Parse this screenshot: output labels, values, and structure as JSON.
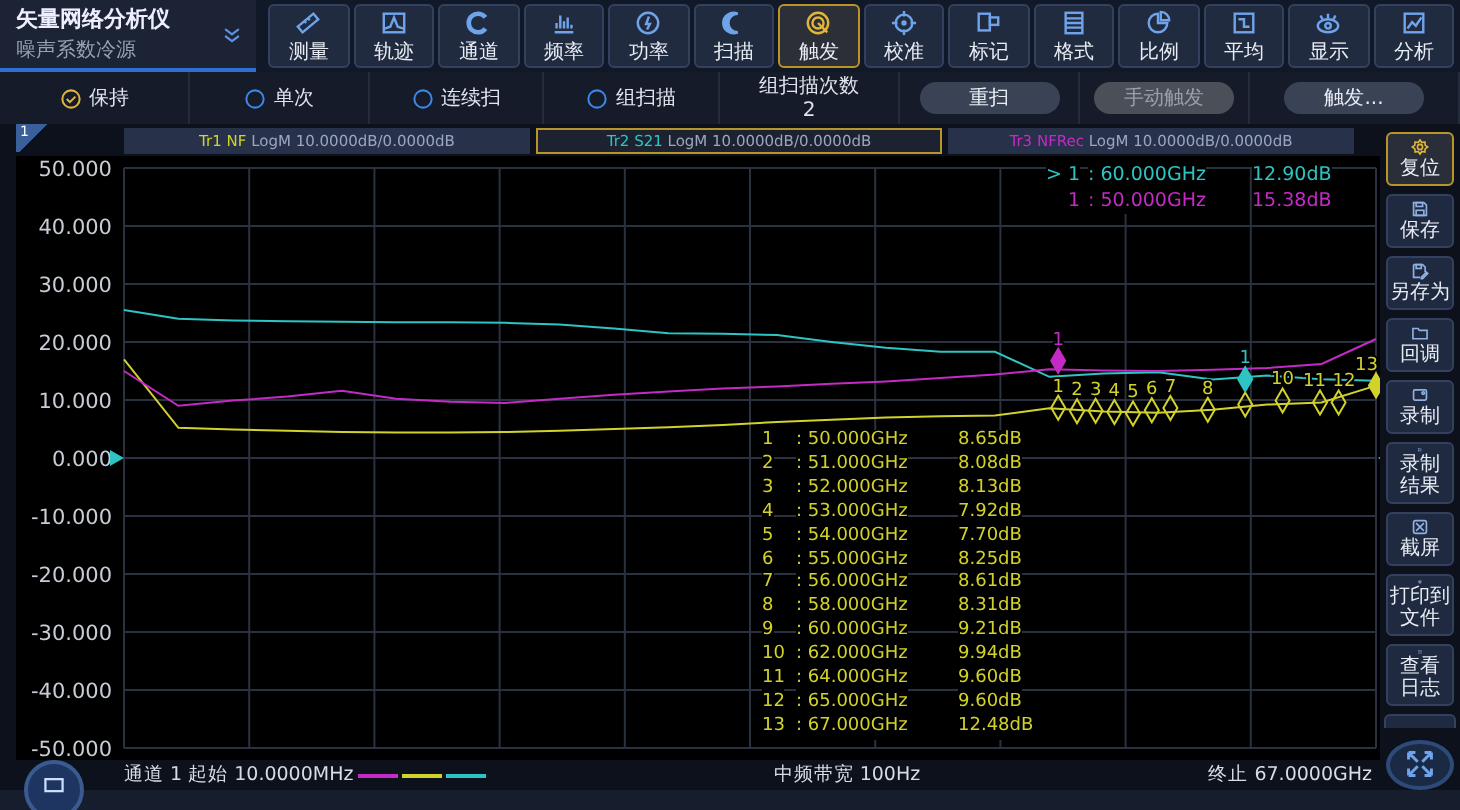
{
  "app": {
    "title": "矢量网络分析仪",
    "subtitle": "噪声系数冷源"
  },
  "toolbar": [
    {
      "label": "测量",
      "selected": false
    },
    {
      "label": "轨迹",
      "selected": false
    },
    {
      "label": "通道",
      "selected": false
    },
    {
      "label": "频率",
      "selected": false
    },
    {
      "label": "功率",
      "selected": false
    },
    {
      "label": "扫描",
      "selected": false
    },
    {
      "label": "触发",
      "selected": true
    },
    {
      "label": "校准",
      "selected": false
    },
    {
      "label": "标记",
      "selected": false
    },
    {
      "label": "格式",
      "selected": false
    },
    {
      "label": "比例",
      "selected": false
    },
    {
      "label": "平均",
      "selected": false
    },
    {
      "label": "显示",
      "selected": false
    },
    {
      "label": "分析",
      "selected": false
    }
  ],
  "trigger_modes": [
    {
      "label": "保持",
      "checked": true
    },
    {
      "label": "单次",
      "checked": false
    },
    {
      "label": "连续扫",
      "checked": false
    },
    {
      "label": "组扫描",
      "checked": false
    }
  ],
  "group_sweep": {
    "label": "组扫描次数",
    "value": "2"
  },
  "actions": [
    {
      "label": "重扫",
      "disabled": false
    },
    {
      "label": "手动触发",
      "disabled": true
    },
    {
      "label": "触发...",
      "disabled": false
    }
  ],
  "channel": {
    "number": "1",
    "start": "通道 1 起始 10.0000MHz",
    "if_bandwidth": "中频带宽 100Hz",
    "stop": "终止 67.0000GHz"
  },
  "plot": {
    "chart_data": {
      "type": "line",
      "grid": true,
      "ylim": [
        -50,
        50
      ],
      "yticks": [
        {
          "value": 50,
          "label": "50.000"
        },
        {
          "value": 40,
          "label": "40.000"
        },
        {
          "value": 30,
          "label": "30.000"
        },
        {
          "value": 20,
          "label": "20.000"
        },
        {
          "value": 10,
          "label": "10.000"
        },
        {
          "value": 0,
          "label": "0.000"
        },
        {
          "value": -10,
          "label": "-10.000"
        },
        {
          "value": -20,
          "label": "-20.000"
        },
        {
          "value": -30,
          "label": "-30.000"
        },
        {
          "value": -40,
          "label": "-40.000"
        },
        {
          "value": -50,
          "label": "-50.000"
        }
      ],
      "categories": [
        null,
        null,
        null,
        null,
        null,
        null,
        null,
        null,
        null,
        null,
        null,
        null,
        null,
        null,
        null,
        null,
        null,
        null,
        null,
        null,
        null,
        null,
        null,
        null
      ],
      "series": [
        {
          "name": "Tr1 NF",
          "color": "#d2d22c",
          "values": [
            17,
            5.2,
            4.9,
            4.7,
            4.5,
            4.4,
            4.4,
            4.5,
            4.7,
            5,
            5.3,
            5.7,
            6.2,
            6.6,
            7,
            7.2,
            7.3,
            8.6,
            8,
            7.8,
            8.3,
            9.2,
            9.6,
            12.5
          ]
        },
        {
          "name": "Tr2 S21",
          "color": "#2ec4c4",
          "values": [
            25.5,
            24,
            23.7,
            23.6,
            23.5,
            23.4,
            23.4,
            23.3,
            23,
            22.3,
            21.5,
            21.4,
            21.2,
            20,
            19,
            18.3,
            18.3,
            14,
            14.6,
            14.8,
            13.5,
            14.2,
            13.6,
            13.3
          ]
        },
        {
          "name": "Tr3 NFRec",
          "color": "#c42ac4",
          "values": [
            15,
            9,
            9.9,
            10.6,
            11.6,
            10.2,
            9.7,
            9.5,
            10.2,
            10.9,
            11.5,
            12,
            12.3,
            12.8,
            13.2,
            13.8,
            14.4,
            15.3,
            15.1,
            15,
            15.2,
            15.5,
            16.2,
            20.5
          ]
        }
      ]
    }
  },
  "traces": [
    {
      "format": "LogM 10.0000dB/0.0000dB",
      "selected": false,
      "plot_markers": [
        {
          "label": "1",
          "active": false
        },
        {
          "label": "2",
          "active": false
        },
        {
          "label": "3",
          "active": false
        },
        {
          "label": "4",
          "active": false
        },
        {
          "label": "5",
          "active": false
        },
        {
          "label": "6",
          "active": false
        },
        {
          "label": "7",
          "active": false
        },
        {
          "label": "8",
          "active": false
        },
        {
          "active": false
        },
        {
          "label": "10",
          "active": false
        },
        {
          "label": "11",
          "active": false
        },
        {
          "label": "12",
          "active": false
        },
        {
          "label": "13",
          "active": true
        }
      ],
      "marker_table": [
        {
          "number": "1",
          "frequency": ": 50.000GHz",
          "value": "8.65dB"
        },
        {
          "number": "2",
          "frequency": ": 51.000GHz",
          "value": "8.08dB"
        },
        {
          "number": "3",
          "frequency": ": 52.000GHz",
          "value": "8.13dB"
        },
        {
          "number": "4",
          "frequency": ": 53.000GHz",
          "value": "7.92dB"
        },
        {
          "number": "5",
          "frequency": ": 54.000GHz",
          "value": "7.70dB"
        },
        {
          "number": "6",
          "frequency": ": 55.000GHz",
          "value": "8.25dB"
        },
        {
          "number": "7",
          "frequency": ": 56.000GHz",
          "value": "8.61dB"
        },
        {
          "number": "8",
          "frequency": ": 58.000GHz",
          "value": "8.31dB"
        },
        {
          "number": "9",
          "frequency": ": 60.000GHz",
          "value": "9.21dB"
        },
        {
          "number": "10",
          "frequency": ": 62.000GHz",
          "value": "9.94dB"
        },
        {
          "number": "11",
          "frequency": ": 64.000GHz",
          "value": "9.60dB"
        },
        {
          "number": "12",
          "frequency": ": 65.000GHz",
          "value": "9.60dB"
        },
        {
          "number": "13",
          "frequency": ": 67.000GHz",
          "value": "12.48dB"
        }
      ]
    },
    {
      "format": "LogM 10.0000dB/0.0000dB",
      "selected": true,
      "plot_markers": [
        {
          "label": "1",
          "active": true
        }
      ],
      "readouts": [
        {
          "number": "> 1",
          "frequency": ": 60.000GHz",
          "value": "12.90dB"
        }
      ]
    },
    {
      "format": "LogM 10.0000dB/0.0000dB",
      "selected": false,
      "plot_markers": [
        {
          "label": "1",
          "active": true
        }
      ],
      "readouts": [
        {
          "number": "1",
          "frequency": ": 50.000GHz",
          "value": "15.38dB"
        }
      ]
    }
  ],
  "sidebar": [
    {
      "label": "复位",
      "selected": true
    },
    {
      "label": "保存",
      "selected": false
    },
    {
      "label": "另存为",
      "selected": false
    },
    {
      "label": "回调",
      "selected": false
    },
    {
      "label": "录制",
      "selected": false
    },
    {
      "label": "录制结果",
      "selected": false
    },
    {
      "label": "截屏",
      "selected": false
    },
    {
      "label": "打印到文件",
      "selected": false
    },
    {
      "label": "查看日志",
      "selected": false
    }
  ]
}
